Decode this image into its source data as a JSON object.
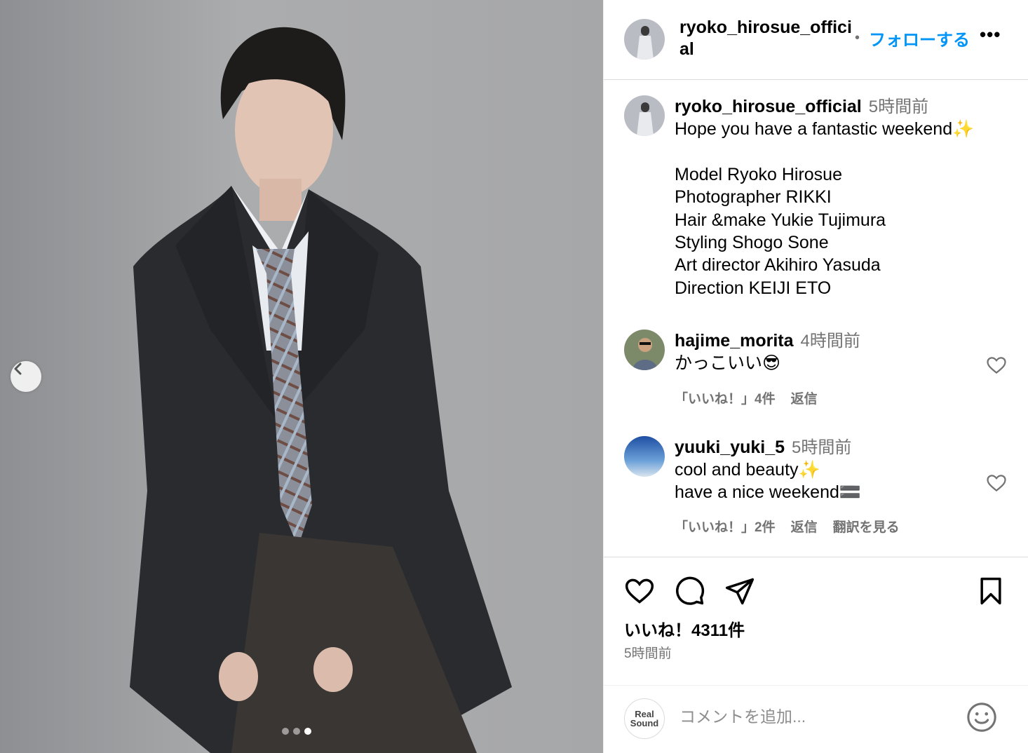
{
  "post": {
    "image_alt": "Photo of a person in a dark suit jacket, white shirt and plaid tie leaning against a grey wall",
    "carousel_dots": 3,
    "carousel_active": 3
  },
  "header": {
    "username": "ryoko_hirosue_official",
    "bullet": "•",
    "follow_label": "フォローする",
    "more_label": "•••"
  },
  "caption": {
    "username": "ryoko_hirosue_official",
    "time": "5時間前",
    "lines": [
      "Hope you have a fantastic weekend✨",
      "",
      "Model Ryoko Hirosue",
      "Photographer RIKKI",
      "Hair &make Yukie Tujimura",
      "Styling Shogo Sone",
      "Art director Akihiro Yasuda",
      "Direction KEIJI ETO"
    ]
  },
  "comments": [
    {
      "username": "hajime_morita",
      "time": "4時間前",
      "lines": [
        "かっこいい😎"
      ],
      "likes": "「いいね！」4件",
      "reply": "返信"
    },
    {
      "username": "yuuki_yuki_5",
      "time": "5時間前",
      "lines": [
        "cool and beauty✨",
        "have  a nice weekend🟰"
      ],
      "likes": "「いいね！」2件",
      "reply": "返信",
      "translate": "翻訳を見る"
    }
  ],
  "footer": {
    "likes": "いいね！4311件",
    "time": "5時間前",
    "comment_placeholder": "コメントを追加...",
    "my_avatar_line1": "Real",
    "my_avatar_line2": "Sound"
  },
  "icons": {
    "nav_prev": "chevron-left-icon",
    "like": "heart-icon",
    "comment": "comment-bubble-icon",
    "share": "paper-plane-icon",
    "save": "bookmark-icon",
    "emoji": "smiley-icon"
  },
  "colors": {
    "follow": "#0095f6",
    "muted": "#737373",
    "border": "#dbdbdb"
  }
}
